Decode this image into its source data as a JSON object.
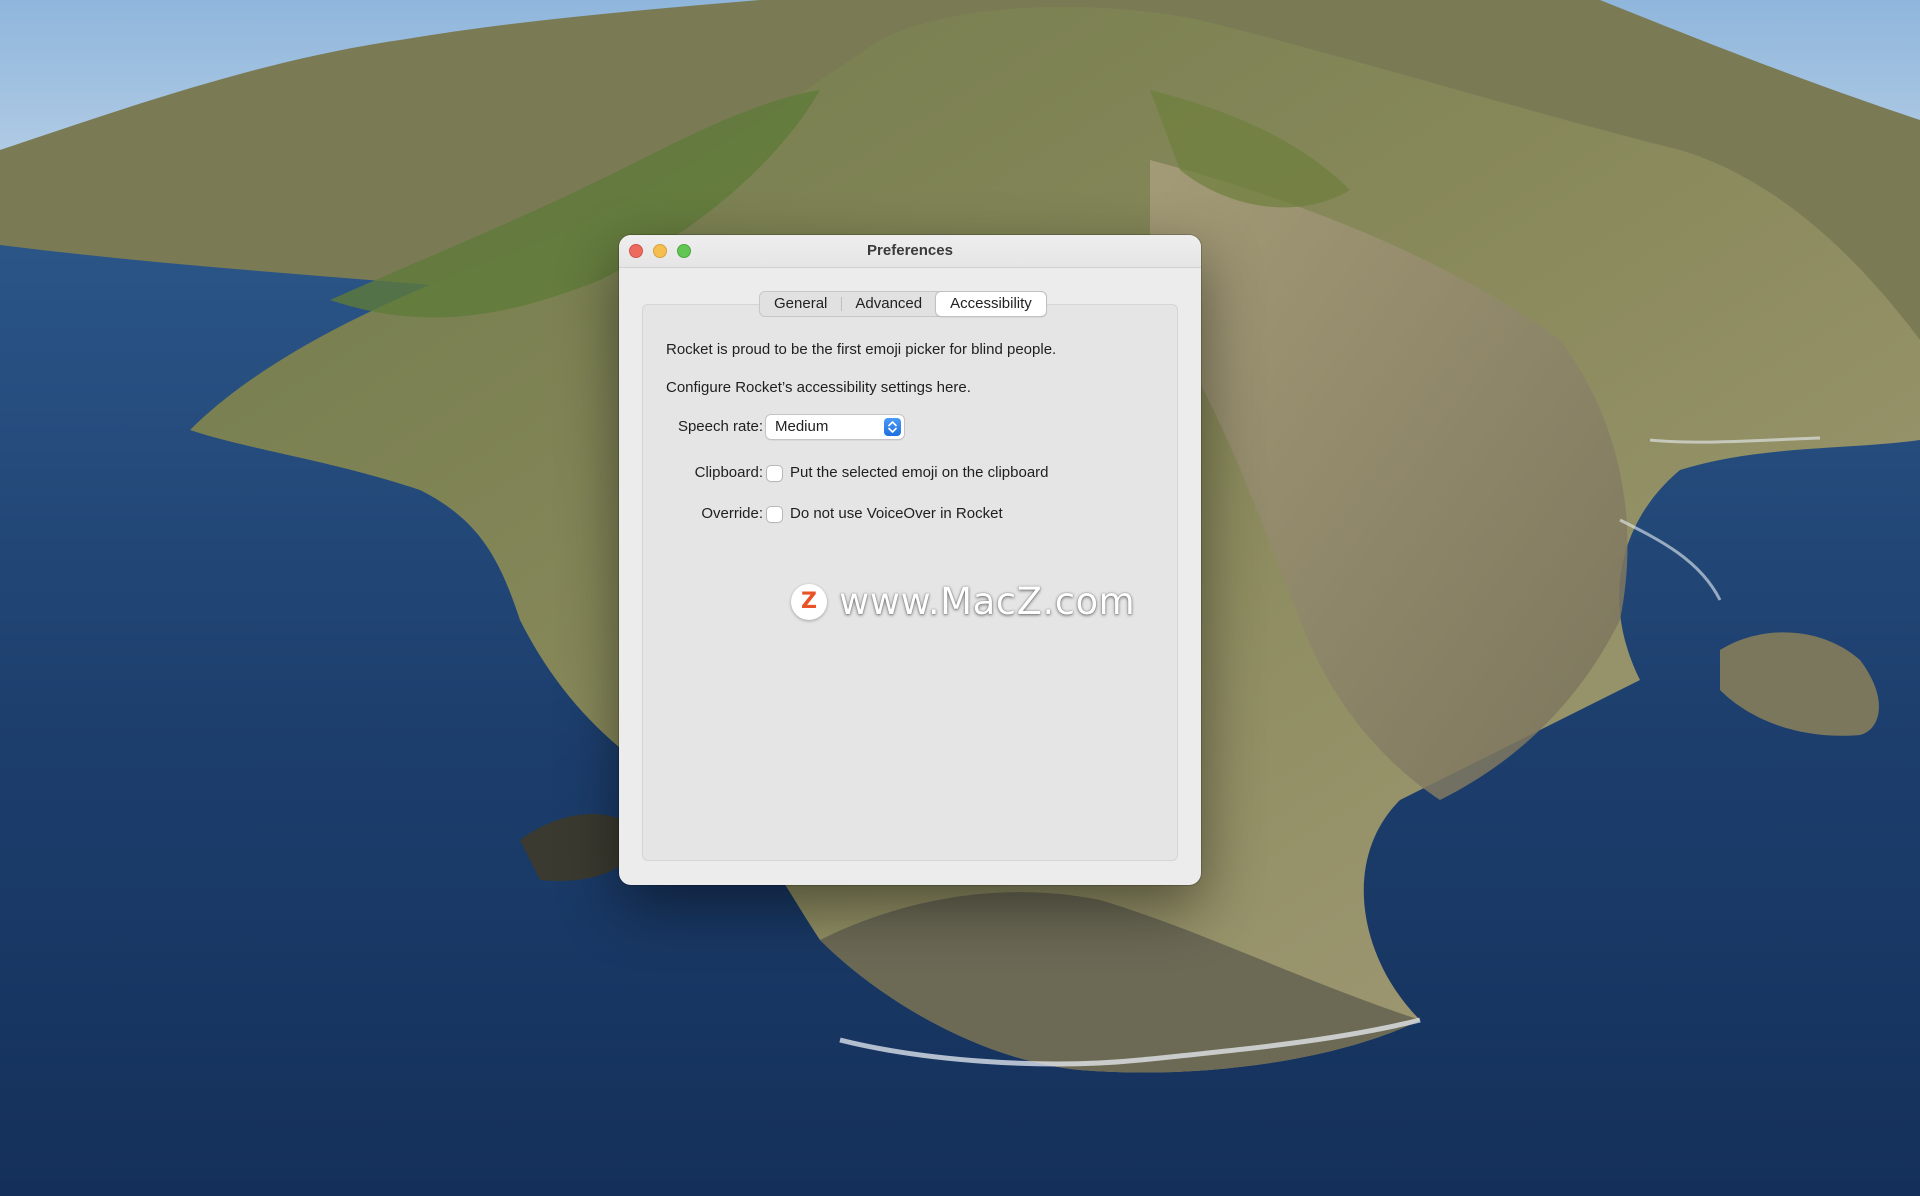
{
  "window": {
    "title": "Preferences"
  },
  "tabs": [
    {
      "label": "General",
      "selected": false
    },
    {
      "label": "Advanced",
      "selected": false
    },
    {
      "label": "Accessibility",
      "selected": true
    }
  ],
  "accessibility": {
    "intro_line_1": "Rocket is proud to be the first emoji picker for blind people.",
    "intro_line_2": "Configure Rocket’s accessibility settings here.",
    "speech_rate": {
      "label": "Speech rate:",
      "value": "Medium"
    },
    "clipboard": {
      "label": "Clipboard:",
      "checkbox_label": "Put the selected emoji on the clipboard",
      "checked": false
    },
    "override": {
      "label": "Override:",
      "checkbox_label": "Do not use VoiceOver in Rocket",
      "checked": false
    }
  },
  "watermark": {
    "logo_letter": "Z",
    "text": "www.MacZ.com"
  },
  "colors": {
    "close": "#ed6a5e",
    "minimize": "#f5bf4f",
    "zoom": "#62c554",
    "accent": "#1f6fe0",
    "watermark_logo": "#e8532a"
  }
}
